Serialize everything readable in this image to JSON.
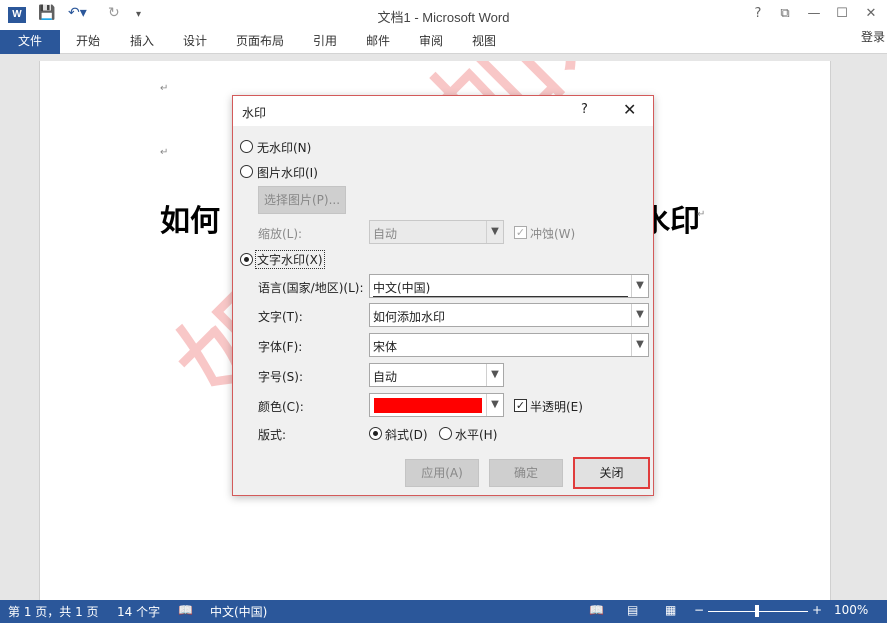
{
  "window": {
    "title": "文档1 - Microsoft Word",
    "icon": "W",
    "controls": {
      "help": "?",
      "restore": "⧉",
      "minimize": "—",
      "maximize": "☐",
      "close": "✕"
    }
  },
  "quick_access": {
    "save": "save-icon",
    "undo": "undo-icon",
    "redo": "redo-icon",
    "customize": "customize-icon"
  },
  "ribbon": {
    "tabs": [
      "文件",
      "开始",
      "插入",
      "设计",
      "页面布局",
      "引用",
      "邮件",
      "审阅",
      "视图"
    ],
    "login": "登录"
  },
  "document": {
    "text": "如何",
    "text_end": "水印",
    "watermark": "如何添加水印"
  },
  "dialog": {
    "title": "水印",
    "help": "?",
    "close": "✕",
    "no_watermark": "无水印(N)",
    "picture_watermark": "图片水印(I)",
    "select_picture": "选择图片(P)...",
    "scale_label": "缩放(L):",
    "scale_value": "自动",
    "washout": "冲蚀(W)",
    "text_watermark": "文字水印(X)",
    "language_label": "语言(国家/地区)(L):",
    "language_value": "中文(中国)",
    "text_label": "文字(T):",
    "text_value": "如何添加水印",
    "font_label": "字体(F):",
    "font_value": "宋体",
    "size_label": "字号(S):",
    "size_value": "自动",
    "color_label": "颜色(C):",
    "color_value": "#ff0000",
    "semitransparent": "半透明(E)",
    "layout_label": "版式:",
    "diagonal": "斜式(D)",
    "horizontal": "水平(H)",
    "apply": "应用(A)",
    "ok": "确定",
    "close_button": "关闭"
  },
  "status": {
    "page": "第 1 页，共 1 页",
    "words": "14 个字",
    "language": "中文(中国)",
    "zoom": "100%",
    "zoom_minus": "−",
    "zoom_plus": "+"
  },
  "colors": {
    "accent": "#2b579a",
    "highlight": "#e03c3c"
  }
}
